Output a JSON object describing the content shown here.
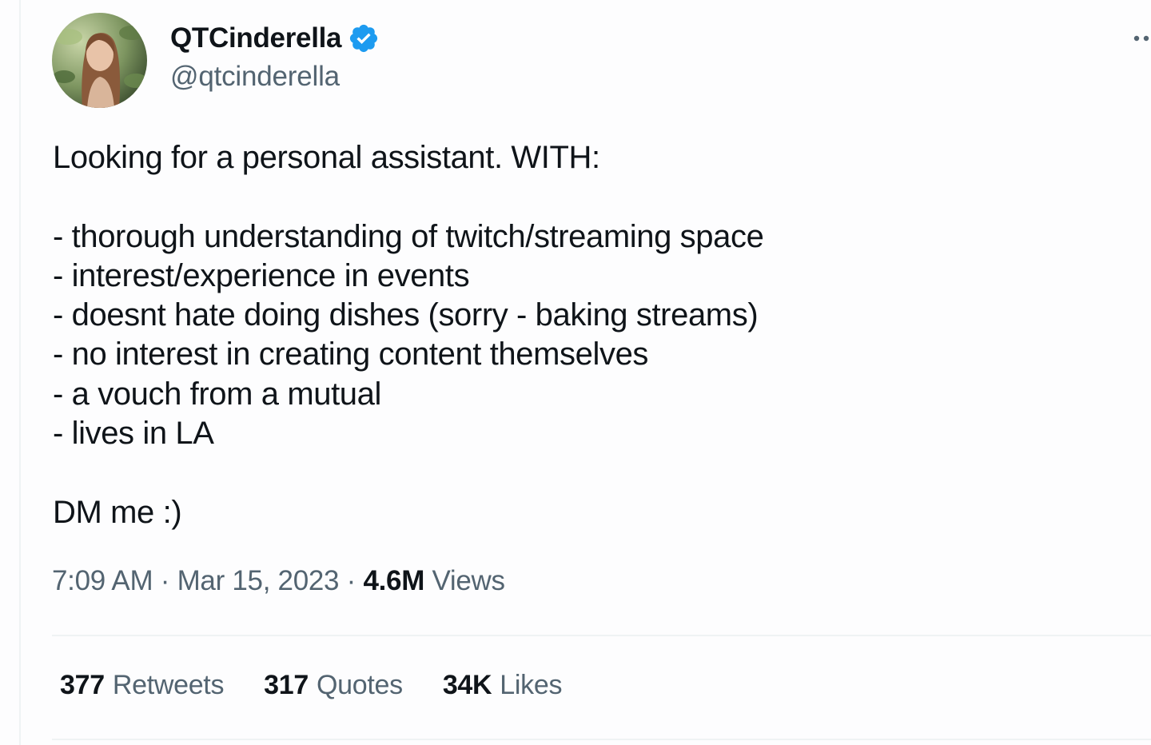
{
  "author": {
    "display_name": "QTCinderella",
    "handle": "@qtcinderella",
    "verified": true,
    "verified_color": "#1d9bf0",
    "avatar_icon": "profile-photo"
  },
  "tweet": {
    "lines": [
      "Looking for a personal assistant. WITH:",
      "",
      "- thorough understanding of twitch/streaming space",
      "- interest/experience in events",
      "- doesnt hate doing dishes (sorry - baking streams)",
      "- no interest in creating content themselves",
      "- a vouch from a mutual",
      "- lives in LA",
      "",
      "DM me :)"
    ]
  },
  "meta": {
    "time": "7:09 AM",
    "separator": "·",
    "date": "Mar 15, 2023",
    "views_count": "4.6M",
    "views_label": "Views"
  },
  "stats": {
    "retweets_count": "377",
    "retweets_label": "Retweets",
    "quotes_count": "317",
    "quotes_label": "Quotes",
    "likes_count": "34K",
    "likes_label": "Likes"
  },
  "colors": {
    "text_primary": "#0f1419",
    "text_secondary": "#536471",
    "divider": "#eff3f4"
  },
  "icons": {
    "more": "more-dots-icon",
    "verified": "verified-badge-icon"
  }
}
